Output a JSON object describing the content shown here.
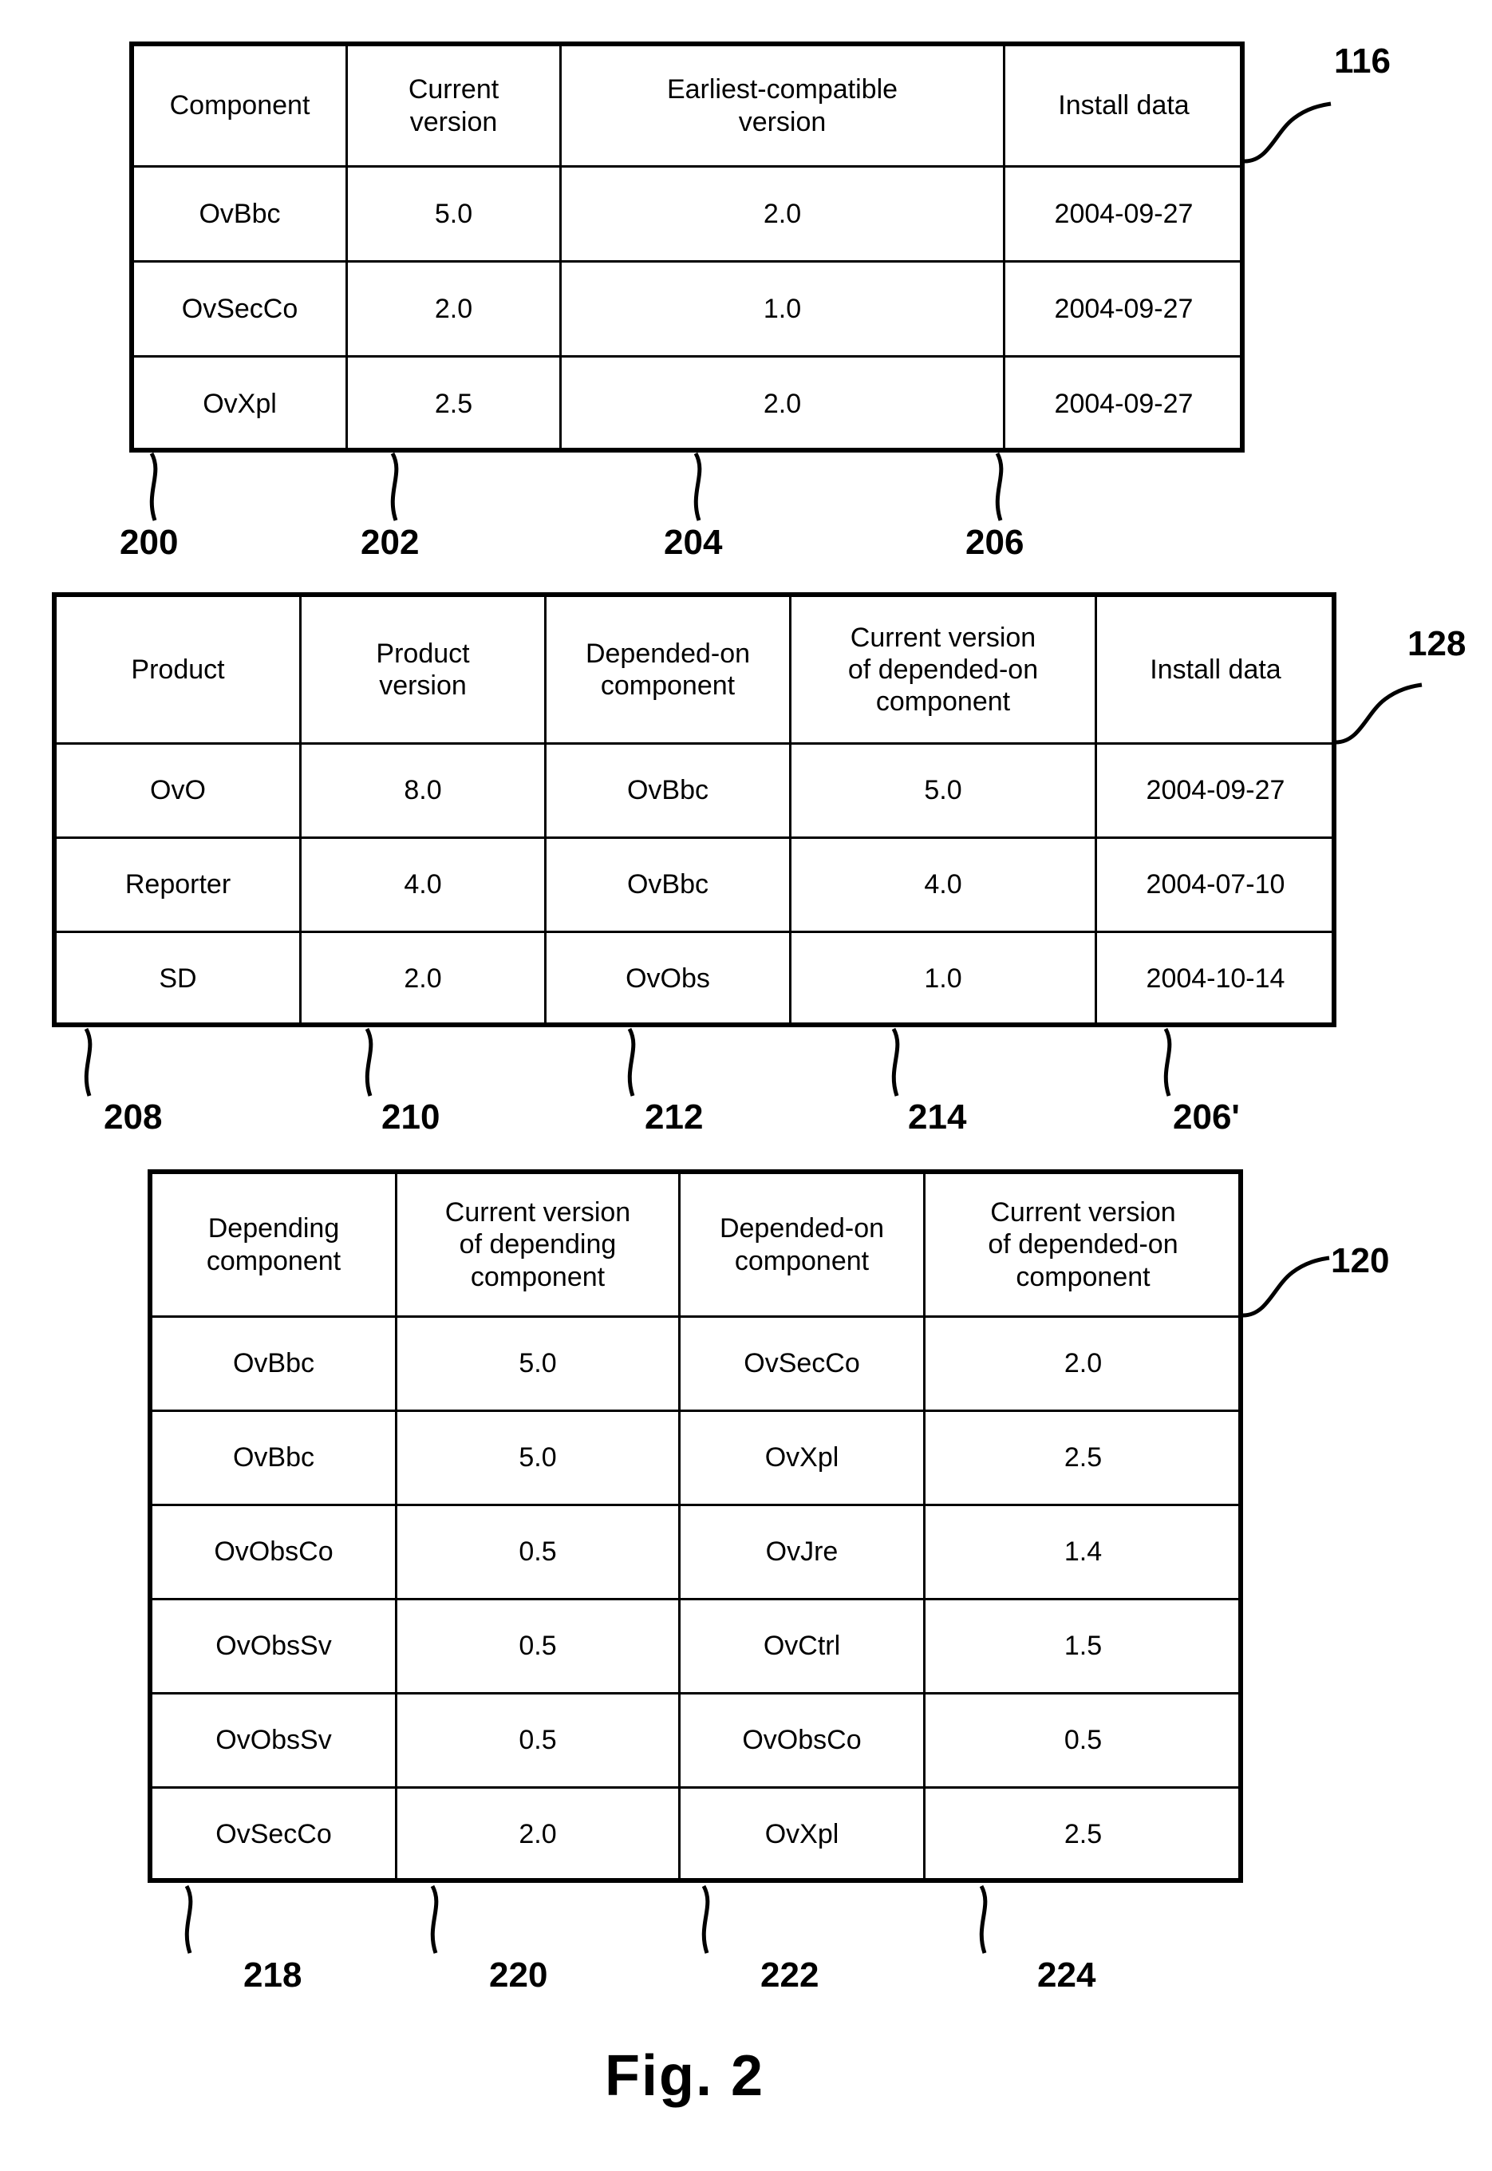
{
  "figure": {
    "caption": "Fig.  2"
  },
  "table_116": {
    "ref": "116",
    "columns": [
      "Component",
      "Current\nversion",
      "Earliest-compatible\nversion",
      "Install data"
    ],
    "column_refs": [
      "200",
      "202",
      "204",
      "206"
    ],
    "rows": [
      [
        "OvBbc",
        "5.0",
        "2.0",
        "2004-09-27"
      ],
      [
        "OvSecCo",
        "2.0",
        "1.0",
        "2004-09-27"
      ],
      [
        "OvXpl",
        "2.5",
        "2.0",
        "2004-09-27"
      ]
    ]
  },
  "table_128": {
    "ref": "128",
    "columns": [
      "Product",
      "Product\nversion",
      "Depended-on\ncomponent",
      "Current version\nof depended-on\ncomponent",
      "Install data"
    ],
    "column_refs": [
      "208",
      "210",
      "212",
      "214",
      "206'"
    ],
    "rows": [
      [
        "OvO",
        "8.0",
        "OvBbc",
        "5.0",
        "2004-09-27"
      ],
      [
        "Reporter",
        "4.0",
        "OvBbc",
        "4.0",
        "2004-07-10"
      ],
      [
        "SD",
        "2.0",
        "OvObs",
        "1.0",
        "2004-10-14"
      ]
    ]
  },
  "table_120": {
    "ref": "120",
    "columns": [
      "Depending\ncomponent",
      "Current version\nof depending\ncomponent",
      "Depended-on\ncomponent",
      "Current version\nof depended-on\ncomponent"
    ],
    "column_refs": [
      "218",
      "220",
      "222",
      "224"
    ],
    "rows": [
      [
        "OvBbc",
        "5.0",
        "OvSecCo",
        "2.0"
      ],
      [
        "OvBbc",
        "5.0",
        "OvXpl",
        "2.5"
      ],
      [
        "OvObsCo",
        "0.5",
        "OvJre",
        "1.4"
      ],
      [
        "OvObsSv",
        "0.5",
        "OvCtrl",
        "1.5"
      ],
      [
        "OvObsSv",
        "0.5",
        "OvObsCo",
        "0.5"
      ],
      [
        "OvSecCo",
        "2.0",
        "OvXpl",
        "2.5"
      ]
    ]
  }
}
